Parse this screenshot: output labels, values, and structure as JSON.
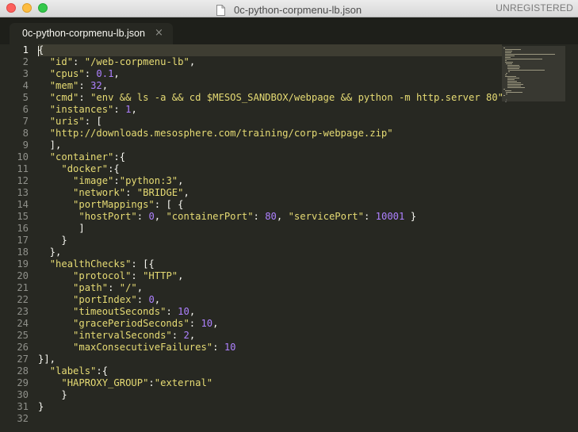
{
  "window": {
    "title": "0c-python-corpmenu-lb.json",
    "license_status": "UNREGISTERED"
  },
  "tab": {
    "label": "0c-python-corpmenu-lb.json",
    "close_glyph": "×"
  },
  "theme": {
    "background": "#272822",
    "string": "#e6db74",
    "number": "#ae81ff"
  },
  "editor": {
    "active_line": 1,
    "lines": [
      {
        "n": "1",
        "code": "{"
      },
      {
        "n": "2",
        "code": "  \"id\": \"/web-corpmenu-lb\","
      },
      {
        "n": "3",
        "code": "  \"cpus\": 0.1,"
      },
      {
        "n": "4",
        "code": "  \"mem\": 32,"
      },
      {
        "n": "5",
        "code": "  \"cmd\": \"env && ls -a && cd $MESOS_SANDBOX/webpage && python -m http.server 80\","
      },
      {
        "n": "6",
        "code": "  \"instances\": 1,"
      },
      {
        "n": "7",
        "code": "  \"uris\": ["
      },
      {
        "n": "8",
        "code": "  \"http://downloads.mesosphere.com/training/corp-webpage.zip\""
      },
      {
        "n": "9",
        "code": "  ],"
      },
      {
        "n": "10",
        "code": "  \"container\":{"
      },
      {
        "n": "11",
        "code": "    \"docker\":{"
      },
      {
        "n": "12",
        "code": "      \"image\":\"python:3\","
      },
      {
        "n": "13",
        "code": "      \"network\": \"BRIDGE\","
      },
      {
        "n": "14",
        "code": "      \"portMappings\": [ {"
      },
      {
        "n": "15",
        "code": "       \"hostPort\": 0, \"containerPort\": 80, \"servicePort\": 10001 }"
      },
      {
        "n": "16",
        "code": "       ]"
      },
      {
        "n": "17",
        "code": "    }"
      },
      {
        "n": "18",
        "code": "  },"
      },
      {
        "n": "19",
        "code": "  \"healthChecks\": [{"
      },
      {
        "n": "20",
        "code": "      \"protocol\": \"HTTP\","
      },
      {
        "n": "21",
        "code": "      \"path\": \"/\","
      },
      {
        "n": "22",
        "code": "      \"portIndex\": 0,"
      },
      {
        "n": "23",
        "code": "      \"timeoutSeconds\": 10,"
      },
      {
        "n": "24",
        "code": "      \"gracePeriodSeconds\": 10,"
      },
      {
        "n": "25",
        "code": "      \"intervalSeconds\": 2,"
      },
      {
        "n": "26",
        "code": "      \"maxConsecutiveFailures\": 10"
      },
      {
        "n": "27",
        "code": "}],"
      },
      {
        "n": "28",
        "code": "  \"labels\":{"
      },
      {
        "n": "29",
        "code": "    \"HAPROXY_GROUP\":\"external\""
      },
      {
        "n": "30",
        "code": "    }"
      },
      {
        "n": "31",
        "code": "}"
      },
      {
        "n": "32",
        "code": ""
      }
    ]
  }
}
